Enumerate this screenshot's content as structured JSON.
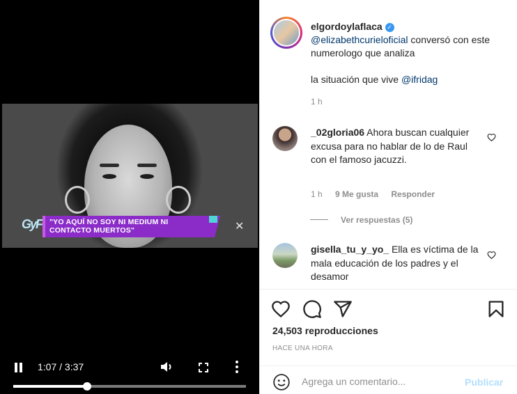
{
  "video": {
    "overlay_text": "\"YO AQUÍ NO SOY NI MEDIUM NI CONTACTO MUERTOS\"",
    "show_logo": "GyF",
    "time": "1:07 / 3:37",
    "progress_fraction": 0.316
  },
  "post": {
    "author": "elgordoylaflaca",
    "caption_mention": "@elizabethcurieloficial",
    "caption_text": " conversó con este numerologo que analiza",
    "caption_line2": "la situación que vive ",
    "caption_mention2": "@ifridag",
    "time": "1 h"
  },
  "comments": [
    {
      "user": "_02gloria06",
      "text": " Ahora buscan cualquier excusa para no hablar de lo de Raul con el famoso jacuzzi.",
      "time": "1 h",
      "likes": "9 Me gusta",
      "reply": "Responder",
      "view_replies": "Ver respuestas (5)"
    },
    {
      "user": "gisella_tu_y_yo_",
      "text": " Ella es víctima de la mala educación de los padres y el desamor"
    }
  ],
  "actions": {
    "views": "24,503 reproducciones",
    "posted": "HACE UNA HORA"
  },
  "composer": {
    "placeholder": "Agrega un comentario...",
    "publish": "Publicar"
  },
  "colors": {
    "overlay_purple": "#8b2cc9",
    "link": "#00376b",
    "publish_disabled": "#b2dffc",
    "verified": "#3897f0"
  }
}
